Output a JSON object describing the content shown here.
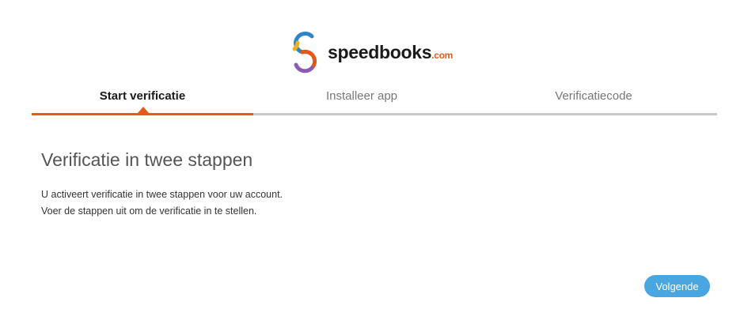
{
  "brand": {
    "name": "speedbooks",
    "suffix": ".com",
    "accent": "#e25a1c"
  },
  "steps": [
    {
      "label": "Start verificatie",
      "active": true
    },
    {
      "label": "Installeer app",
      "active": false
    },
    {
      "label": "Verificatiecode",
      "active": false
    }
  ],
  "content": {
    "title": "Verificatie in twee stappen",
    "line1": "U activeert verificatie in twee stappen voor uw account.",
    "line2": "Voer de stappen uit om de verificatie in te stellen."
  },
  "next_button": {
    "label": "Volgende",
    "color": "#4aa6e0"
  }
}
